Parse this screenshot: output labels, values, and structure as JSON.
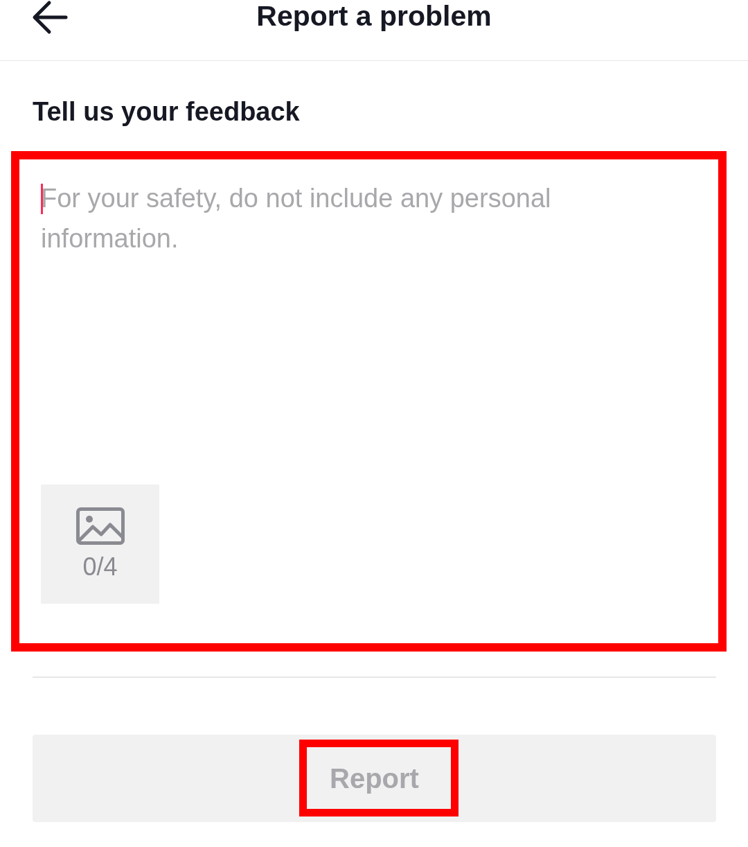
{
  "header": {
    "title": "Report a problem"
  },
  "section_title": "Tell us your feedback",
  "feedback": {
    "placeholder": "For your safety, do not include any personal information.",
    "focused": true,
    "highlighted": true
  },
  "attachments": {
    "count": "0/4"
  },
  "report_button": {
    "label": "Report",
    "disabled": true,
    "highlighted": true
  }
}
